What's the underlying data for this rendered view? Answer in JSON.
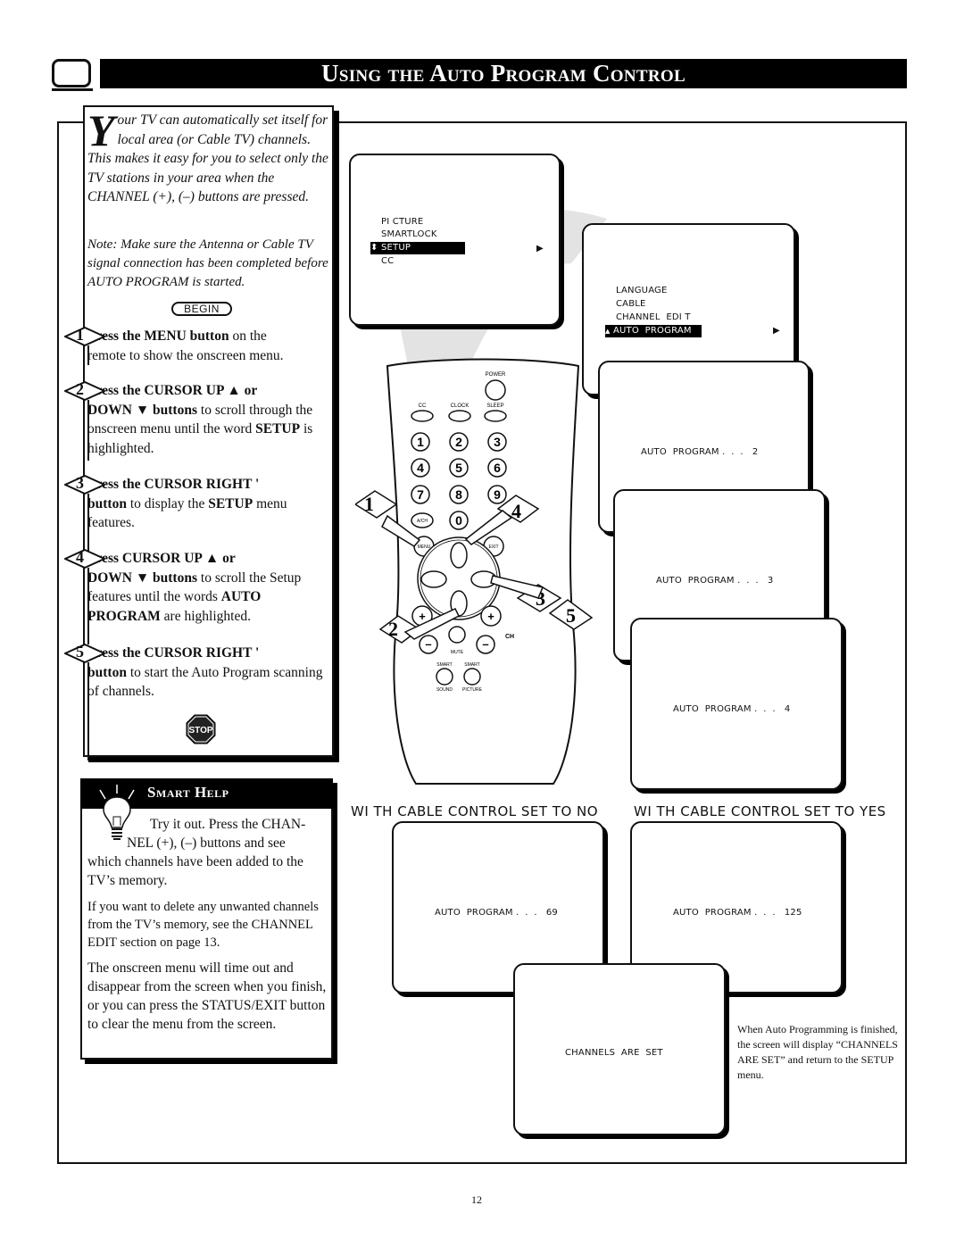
{
  "header": {
    "title": "Using the Auto Program Control",
    "icon": "tv-icon"
  },
  "intro": {
    "dropcap": "Y",
    "text": "our TV can automatically set itself for local area (or Cable TV) channels. This makes it easy for you to select only the TV stations in your area when the CHANNEL (+), (–) buttons are pressed.",
    "note": "Note: Make sure the Antenna or Cable TV signal connection has been completed before AUTO PROGRAM is started.",
    "begin_label": "BEGIN"
  },
  "steps": [
    {
      "number": "1",
      "head": "Press the MENU button",
      "rest_head": " on the",
      "body": "remote to show the onscreen menu."
    },
    {
      "number": "2",
      "head": "Press the CURSOR UP ▲ or",
      "body_bold": "DOWN ▼ buttons",
      "body": " to scroll through the onscreen menu until the word ",
      "body_bold2": "SETUP",
      "body2": " is highlighted."
    },
    {
      "number": "3",
      "head": "Press the CURSOR RIGHT '",
      "body_bold": "button",
      "body": " to display the ",
      "body_bold2": "SETUP",
      "body2": " menu features."
    },
    {
      "number": "4",
      "head": "Press CURSOR UP ▲ or",
      "body_bold": "DOWN ▼ buttons",
      "body": " to scroll the Setup features until the words ",
      "body_bold2": "AUTO PROGRAM",
      "body2": " are highlighted."
    },
    {
      "number": "5",
      "head": "Press the CURSOR RIGHT '",
      "body_bold": "button",
      "body": " to start the Auto Program scanning of channels."
    }
  ],
  "stop_label": "STOP",
  "smart_help": {
    "title": "Smart Help",
    "p1": "Try it out. Press the CHANNEL (+), (–) buttons and see which channels have been added to the TV’s memory.",
    "p1_line1": "Try it out. Press the CHAN-",
    "p1_line2": "NEL (+), (–) buttons and see",
    "p1_rest": "which channels have been added to the TV’s memory.",
    "p2": "If you want to delete any unwanted channels from the TV’s memory, see the CHANNEL EDIT section on page 13.",
    "p3": "The onscreen menu will time out and disappear from the screen when you finish, or you can press the STATUS/EXIT button to clear the menu from the screen."
  },
  "main_menu_screen": {
    "items": [
      "PI CTURE",
      "SMARTLOCK",
      "SETUP",
      "CC"
    ],
    "selected": "SETUP",
    "selected_marker": "⬍",
    "right_arrow": "▶"
  },
  "setup_menu_screen": {
    "items": [
      "LANGUAGE",
      "CABLE",
      "CHANNEL  EDI T",
      "AUTO  PROGRAM"
    ],
    "selected": "AUTO  PROGRAM",
    "selected_marker": "▲",
    "right_arrow": "▶"
  },
  "progress_screens": [
    {
      "text": "AUTO  PROGRAM .  .  .   2"
    },
    {
      "text": "AUTO  PROGRAM .  .  .   3"
    },
    {
      "text": "AUTO  PROGRAM .  .  .   4"
    }
  ],
  "cable_no": {
    "label": "WI TH  CABLE  CONTROL  SET  TO  NO",
    "screen_text": "AUTO  PROGRAM .  .  .   69"
  },
  "cable_yes": {
    "label": "WI TH  CABLE  CONTROL  SET  TO  YES",
    "screen_text": "AUTO  PROGRAM .  .  .   125"
  },
  "final_screen": {
    "text": "CHANNELS  ARE  SET"
  },
  "final_caption": "When Auto Programming is finished, the screen will display “CHANNELS ARE SET” and return to the SETUP menu.",
  "remote": {
    "power": "POWER",
    "cc": "CC",
    "clock": "CLOCK",
    "sleep": "SLEEP",
    "digits": [
      "1",
      "2",
      "3",
      "4",
      "5",
      "6",
      "7",
      "8",
      "9",
      "0"
    ],
    "ach": "A/CH",
    "menu": "MENU",
    "exit": "EXIT",
    "plus": "+",
    "minus": "–",
    "ch": "CH",
    "mute": "MUTE",
    "smart1": "SMART",
    "smart2": "SMART",
    "sound": "SOUND",
    "picture": "PICTURE",
    "callouts": [
      "1",
      "2",
      "3",
      "4",
      "5"
    ]
  },
  "page_number": "12"
}
